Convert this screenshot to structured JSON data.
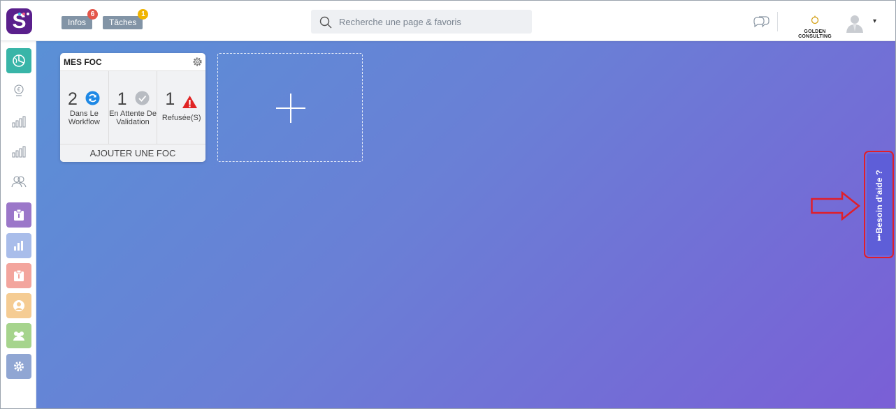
{
  "header": {
    "logo_letter": "S",
    "logo_dot_colors": [
      "#3ec1f3",
      "#f25a8c",
      "#ffffff"
    ],
    "infos": {
      "label": "Infos",
      "count": "6",
      "badge_color": "#e4564a"
    },
    "taches": {
      "label": "Tâches",
      "count": "1",
      "badge_color": "#f0b400"
    },
    "search": {
      "placeholder": "Recherche une page & favoris"
    },
    "company_name": "GOLDEN CONSULTING",
    "dropdown_caret": "▾"
  },
  "sidebar": {
    "items": [
      {
        "name": "sidebar-item-dashboard",
        "icon": "globe-chart-icon",
        "color": "#39b5a8"
      },
      {
        "name": "sidebar-item-finance",
        "icon": "euro-pin-icon",
        "color": ""
      },
      {
        "name": "sidebar-item-stats-1",
        "icon": "bar-chart-icon",
        "color": ""
      },
      {
        "name": "sidebar-item-stats-2",
        "icon": "bar-chart-icon",
        "color": ""
      },
      {
        "name": "sidebar-item-users",
        "icon": "users-icon",
        "color": ""
      },
      {
        "name": "sidebar-item-tasks",
        "icon": "clipboard-icon",
        "color": "#9b77c9"
      },
      {
        "name": "sidebar-item-reports",
        "icon": "bar-chart-icon",
        "color": "#a9bdea"
      },
      {
        "name": "sidebar-item-documents",
        "icon": "clipboard-icon",
        "color": "#f3a59d"
      },
      {
        "name": "sidebar-item-profile",
        "icon": "user-circle-icon",
        "color": "#f5cc93"
      },
      {
        "name": "sidebar-item-team",
        "icon": "group-icon",
        "color": "#a6d48d"
      },
      {
        "name": "sidebar-item-settings",
        "icon": "gear-icon",
        "color": "#90a6d3"
      }
    ]
  },
  "widget": {
    "title": "MES FOC",
    "stats": [
      {
        "count": "2",
        "label_line1": "Dans Le",
        "label_line2": "Workflow",
        "icon": "refresh-icon",
        "color": "#1e88e5"
      },
      {
        "count": "1",
        "label_line1": "En Attente De",
        "label_line2": "Validation",
        "icon": "check-circle-icon",
        "color": "#b8bcc2"
      },
      {
        "count": "1",
        "label_line1": "Refusée(S)",
        "label_line2": "",
        "icon": "warning-icon",
        "color": "#e02424"
      }
    ],
    "footer_label": "AJOUTER UNE FOC"
  },
  "help": {
    "label": "Besoin d'aide ?",
    "highlight_color": "#e01e2a"
  }
}
